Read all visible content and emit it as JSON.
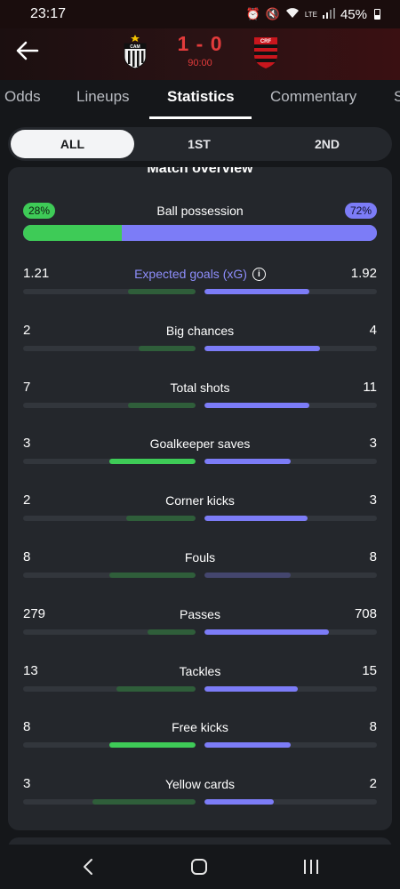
{
  "status_bar": {
    "time": "23:17",
    "battery": "45%",
    "network": "LTE"
  },
  "match": {
    "home_team_icon": "atletico-mineiro-crest-icon",
    "away_team_icon": "flamengo-crest-icon",
    "score": "1 - 0",
    "time": "90:00"
  },
  "tabs": [
    "Odds",
    "Lineups",
    "Statistics",
    "Commentary",
    "S"
  ],
  "active_tab": "Statistics",
  "period": {
    "options": [
      "ALL",
      "1ST",
      "2ND"
    ],
    "selected": "ALL"
  },
  "overview": {
    "title": "Match overview",
    "possession": {
      "label": "Ball possession",
      "home": "28%",
      "away": "72%",
      "home_value": 28,
      "away_value": 72
    },
    "stats": [
      {
        "label": "Expected goals (xG)",
        "home": "1.21",
        "away": "1.92",
        "home_fill": 0.39,
        "away_fill": 0.61,
        "home_color": "#2f5e3a",
        "away_color": "#7c7cf7",
        "accent": true,
        "info": true
      },
      {
        "label": "Big chances",
        "home": "2",
        "away": "4",
        "home_fill": 0.33,
        "away_fill": 0.67,
        "home_color": "#2f5e3a",
        "away_color": "#7c7cf7"
      },
      {
        "label": "Total shots",
        "home": "7",
        "away": "11",
        "home_fill": 0.39,
        "away_fill": 0.61,
        "home_color": "#2f5e3a",
        "away_color": "#7c7cf7"
      },
      {
        "label": "Goalkeeper saves",
        "home": "3",
        "away": "3",
        "home_fill": 0.5,
        "away_fill": 0.5,
        "home_color": "#3ecb57",
        "away_color": "#7c7cf7"
      },
      {
        "label": "Corner kicks",
        "home": "2",
        "away": "3",
        "home_fill": 0.4,
        "away_fill": 0.6,
        "home_color": "#2f5e3a",
        "away_color": "#7c7cf7"
      },
      {
        "label": "Fouls",
        "home": "8",
        "away": "8",
        "home_fill": 0.5,
        "away_fill": 0.5,
        "home_color": "#2f5e3a",
        "away_color": "#44466e"
      },
      {
        "label": "Passes",
        "home": "279",
        "away": "708",
        "home_fill": 0.28,
        "away_fill": 0.72,
        "home_color": "#2f5e3a",
        "away_color": "#7c7cf7"
      },
      {
        "label": "Tackles",
        "home": "13",
        "away": "15",
        "home_fill": 0.46,
        "away_fill": 0.54,
        "home_color": "#2f5e3a",
        "away_color": "#7c7cf7"
      },
      {
        "label": "Free kicks",
        "home": "8",
        "away": "8",
        "home_fill": 0.5,
        "away_fill": 0.5,
        "home_color": "#3ecb57",
        "away_color": "#7c7cf7"
      },
      {
        "label": "Yellow cards",
        "home": "3",
        "away": "2",
        "home_fill": 0.6,
        "away_fill": 0.4,
        "home_color": "#2f5e3a",
        "away_color": "#7c7cf7"
      }
    ]
  },
  "colors": {
    "home": "#3ecb57",
    "away": "#7c7cf7",
    "score": "#e23b3b"
  }
}
